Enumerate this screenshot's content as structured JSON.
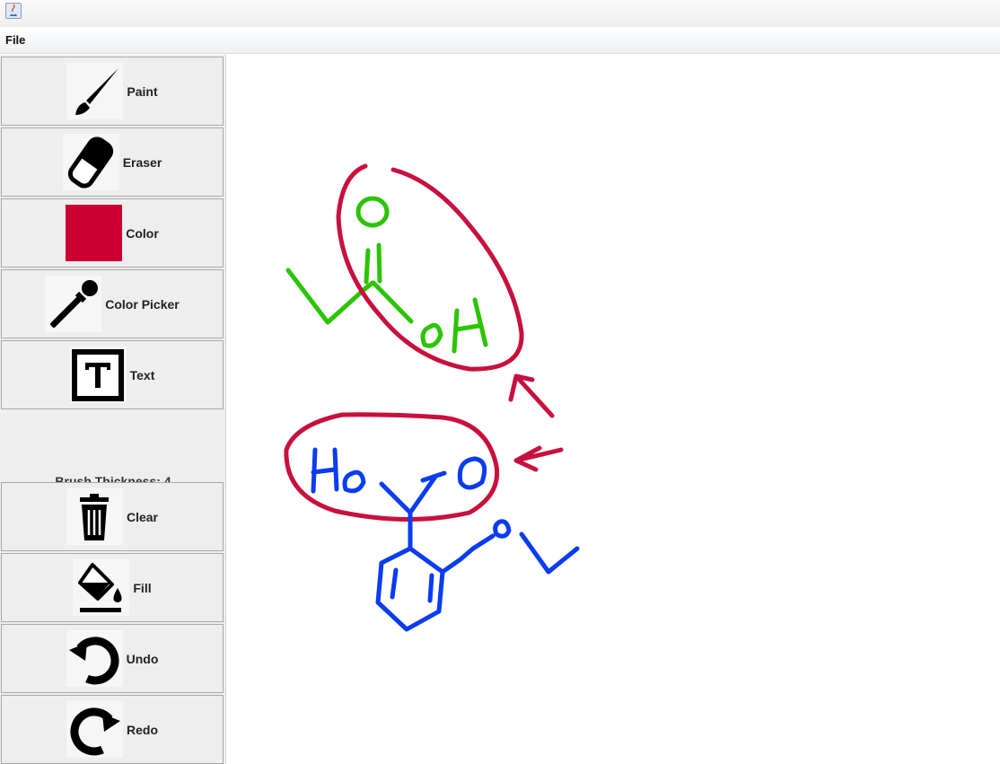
{
  "menu": {
    "file_label": "File"
  },
  "tools": [
    {
      "label": "Paint",
      "icon": "paintbrush-icon"
    },
    {
      "label": "Eraser",
      "icon": "eraser-icon"
    },
    {
      "label": "Color",
      "icon": "color-swatch-icon"
    },
    {
      "label": "Color Picker",
      "icon": "eyedropper-icon"
    },
    {
      "label": "Text",
      "icon": "text-icon"
    },
    {
      "label": "Clear",
      "icon": "trash-icon"
    },
    {
      "label": "Fill",
      "icon": "paint-bucket-icon"
    },
    {
      "label": "Undo",
      "icon": "undo-icon"
    },
    {
      "label": "Redo",
      "icon": "redo-icon"
    }
  ],
  "brush": {
    "thickness_label": "Brush Thickness: 4",
    "value": 4
  },
  "colors": {
    "current": "#cc0033",
    "red_stroke": "#c8103e",
    "green_stroke": "#2bc400",
    "blue_stroke": "#0a3cf0"
  }
}
